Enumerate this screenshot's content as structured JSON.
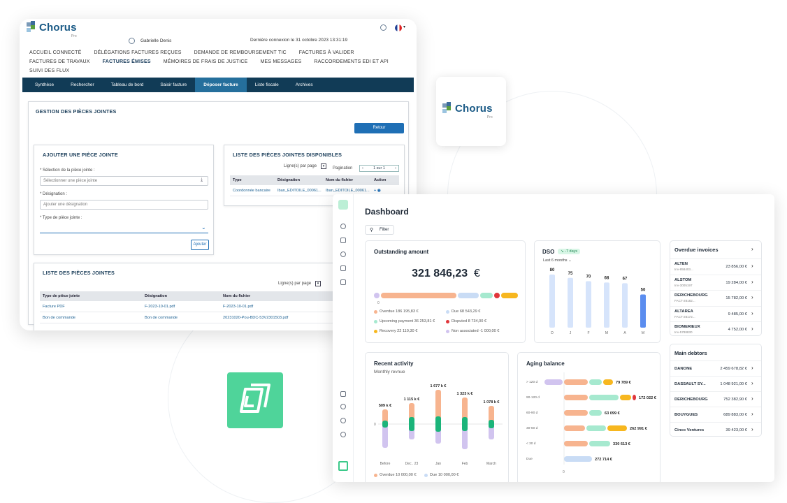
{
  "chorus": {
    "logo": "Chorus",
    "logo_sub": "Pro",
    "user_name": "Gabrielle Denis",
    "last_login": "Dernière connexion le 31 octobre 2023 13:31:19",
    "nav": [
      "Accueil connecté",
      "Délégations factures reçues",
      "Demande de remboursement TIC",
      "Factures à valider",
      "Factures de travaux",
      "Factures émises",
      "Mémoires de frais de justice",
      "Mes messages",
      "Raccordements EDI et API",
      "Suivi des flux"
    ],
    "nav_active": "Factures émises",
    "tabs": [
      "Synthèse",
      "Rechercher",
      "Tableau de bord",
      "Saisir facture",
      "Déposer facture",
      "Liste fiscale",
      "Archives"
    ],
    "tab_active": "Déposer facture",
    "section_title": "Gestion des pièces jointes",
    "back_button": "Retour",
    "add_panel": {
      "title": "Ajouter une pièce jointe",
      "select_label": "* Sélection de la pièce jointe :",
      "select_placeholder": "Sélectionner une pièce jointe",
      "designation_label": "* Désignation :",
      "designation_placeholder": "Ajouter une désignation",
      "type_label": "* Type de pièce jointe :",
      "add_button": "Ajouter"
    },
    "available_panel": {
      "title": "Liste des pièces jointes disponibles",
      "lines_per_page": "Ligne(s) par page",
      "pagination": "Pagination",
      "page_value": "1 sur 1",
      "columns": [
        "Type",
        "Désignation",
        "Nom du fichier",
        "Action"
      ],
      "rows": [
        [
          "Coordonnée bancaire",
          "Iban_EDITOILE_00061...",
          "Iban_EDITOILE_00061..."
        ]
      ]
    },
    "list_panel": {
      "title": "Liste des pièces jointes",
      "lines_per_page": "Ligne(s) par page",
      "columns": [
        "Type de pièce jointe",
        "Désignation",
        "Nom du fichier"
      ],
      "rows": [
        [
          "Facture PDF",
          "F-2023-10-01.pdf",
          "F-2023-10-01.pdf"
        ],
        [
          "Bon de commande",
          "Bon de commande",
          "20231020-Pou-BDC-53V2301503.pdf"
        ]
      ]
    }
  },
  "card_logo": {
    "word": "Chorus",
    "sub": "Pro"
  },
  "dashboard": {
    "title": "Dashboard",
    "filter_button": "Filter",
    "outstanding": {
      "title": "Outstanding amount",
      "amount": "321 846,23",
      "currency": "€",
      "zero": "0",
      "legend": [
        {
          "label": "Overdue 186 195,83 €",
          "color": "#f7b48f"
        },
        {
          "label": "Due 68 543,29 €",
          "color": "#c9dcf5"
        },
        {
          "label": "Upcoming payment 36 253,81 €",
          "color": "#a6e9cf"
        },
        {
          "label": "Disputed 8 734,00 €",
          "color": "#e0363b"
        },
        {
          "label": "Recovery 22 110,30 €",
          "color": "#f7b71f"
        },
        {
          "label": "Non associated -1 000,00 €",
          "color": "#d1c4ef"
        }
      ]
    },
    "dso": {
      "title": "DSO",
      "badge": "-7 days",
      "period": "Last 6 months",
      "months": [
        "D",
        "J",
        "F",
        "M",
        "A",
        "M"
      ],
      "values": [
        80,
        75,
        70,
        68,
        67,
        50
      ]
    },
    "overdue_invoices": {
      "title": "Overdue invoices",
      "items": [
        {
          "name": "ALTEN",
          "ref": "Inv-858403...",
          "amount": "23 856,00 €"
        },
        {
          "name": "ALSTOM",
          "ref": "Inv-3005197",
          "amount": "19 284,00 €"
        },
        {
          "name": "DERICHEBOURG",
          "ref": "FACT-28182...",
          "amount": "15 782,00 €"
        },
        {
          "name": "ALTAREA",
          "ref": "FACT-28172...",
          "amount": "9 485,00 €"
        },
        {
          "name": "BIOMERIEUX",
          "ref": "Inv-5788830",
          "amount": "4 752,00 €"
        }
      ]
    },
    "recent_activity": {
      "title": "Recent activity",
      "subtitle": "Monthly revnue",
      "months": [
        "Before",
        "Dec . 23",
        "Jan",
        "Feb",
        "March"
      ],
      "totals": [
        "509 k €",
        "1 115 k €",
        "1 677 k €",
        "1 323 k €",
        "1 078 k €"
      ],
      "zero": "0",
      "legend": [
        {
          "label": "Overdue 10 000,00 €",
          "color": "#f7b48f"
        },
        {
          "label": "Due 10 000,00 €",
          "color": "#c9dcf5"
        }
      ]
    },
    "aging": {
      "title": "Aging balance",
      "rows": [
        {
          "label": "> 120 d",
          "value": "79 789 €"
        },
        {
          "label": "90-120 d",
          "value": "172 022 €"
        },
        {
          "label": "60-90 d",
          "value": "63 099 €"
        },
        {
          "label": "30-60 d",
          "value": "262 991 €"
        },
        {
          "label": "< 30 d",
          "value": "330 613 €"
        },
        {
          "label": "Due",
          "value": "272 714 €"
        }
      ],
      "zero": "0"
    },
    "main_debtors": {
      "title": "Main debtors",
      "items": [
        {
          "name": "DANONE",
          "amount": "2 459 678,82 €"
        },
        {
          "name": "DASSAULT SY...",
          "amount": "1 048 921,00 €"
        },
        {
          "name": "DERICHEBOURG",
          "amount": "752 382,90 €"
        },
        {
          "name": "BOUYGUES",
          "amount": "689 883,00 €"
        },
        {
          "name": "Cinco Ventures",
          "amount": "39 423,00 €"
        }
      ]
    }
  },
  "chart_data": {
    "type": "bar",
    "categories": [
      "D",
      "J",
      "F",
      "M",
      "A",
      "M"
    ],
    "values": [
      80,
      75,
      70,
      68,
      67,
      50
    ],
    "title": "DSO"
  }
}
